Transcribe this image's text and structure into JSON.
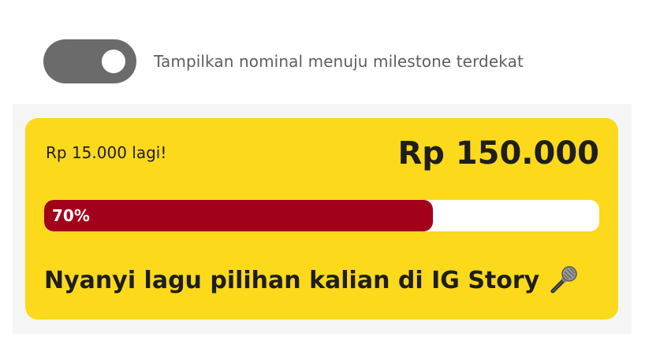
{
  "toggle": {
    "label": "Tampilkan nominal menuju milestone terdekat",
    "state": "on",
    "track_color": "#6b6b6b"
  },
  "milestone_card": {
    "remaining_text": "Rp 15.000 lagi!",
    "target_amount": "Rp 150.000",
    "progress_percent": 70,
    "progress_label": "70%",
    "milestone_text": "Nyanyi lagu pilihan kalian di IG Story",
    "milestone_icon": "microphone-icon",
    "card_color": "#fcd91b",
    "progress_color": "#a3001c"
  }
}
